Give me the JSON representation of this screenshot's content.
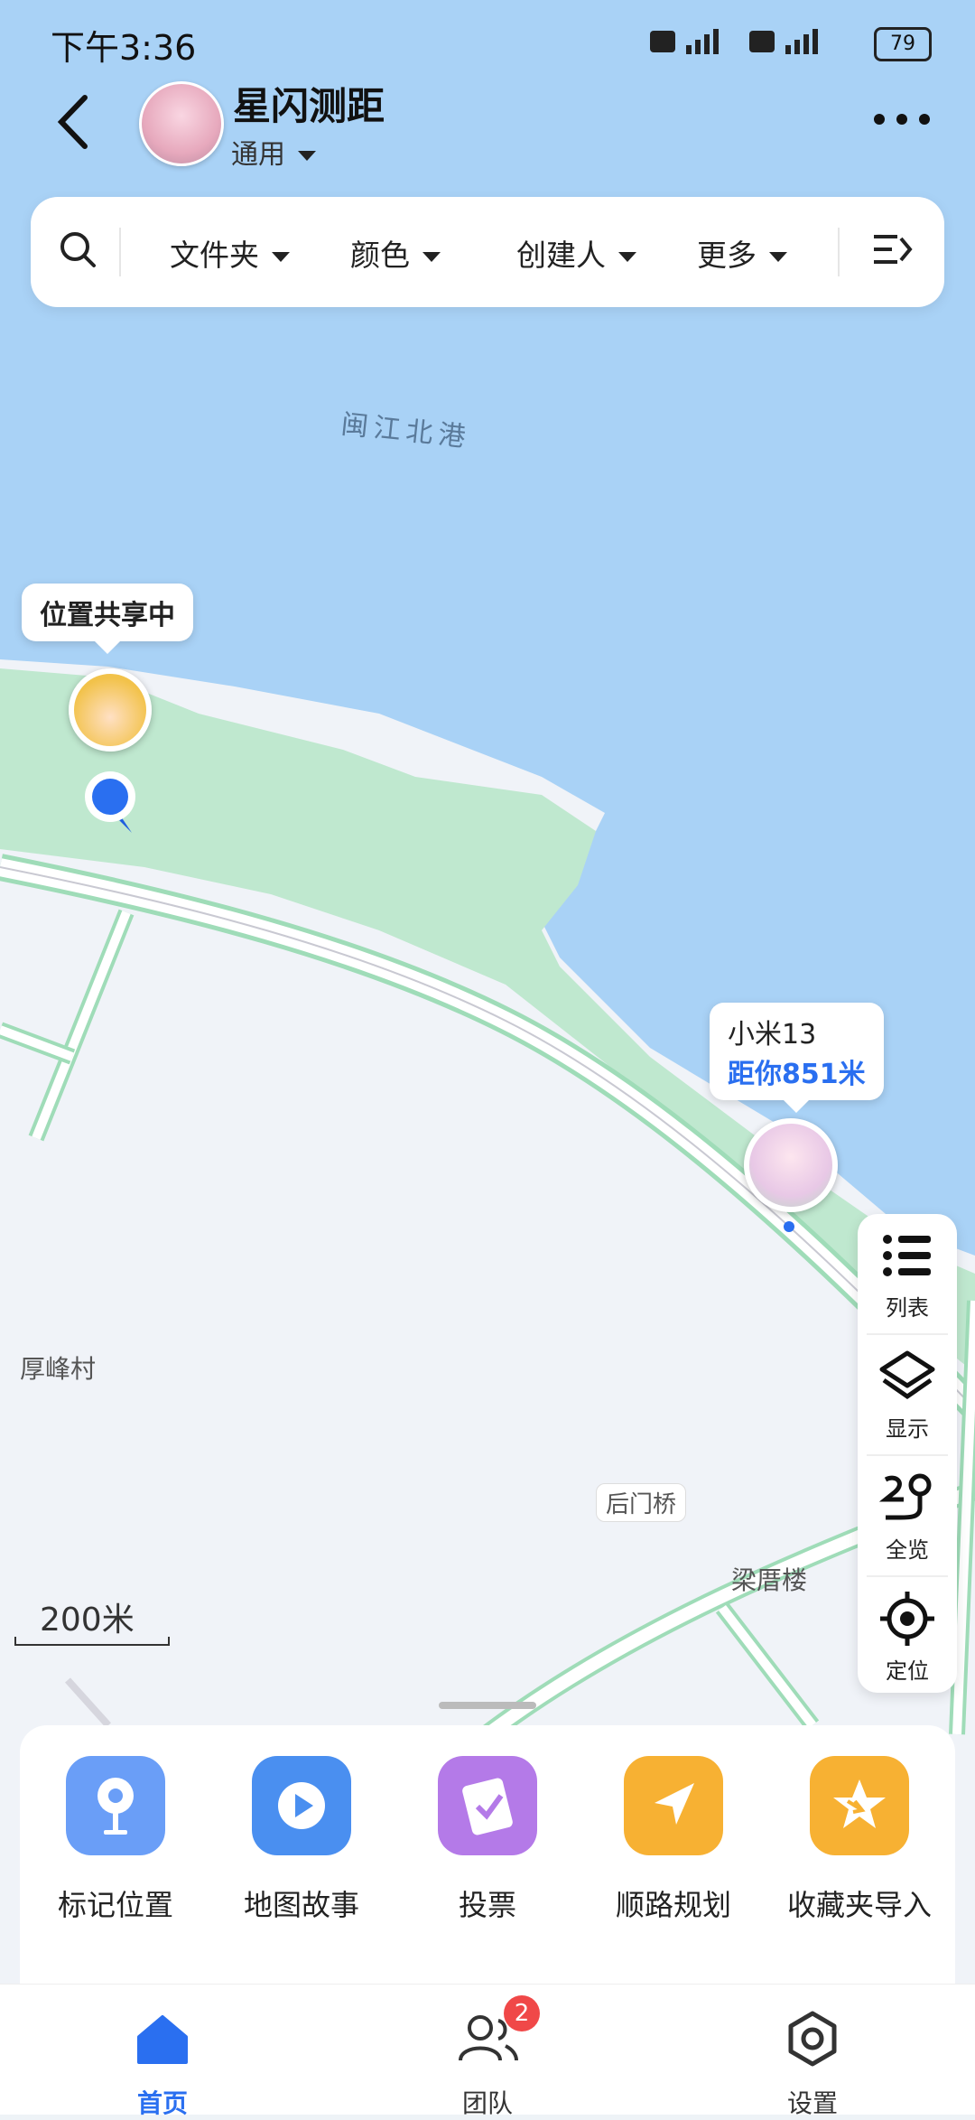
{
  "status_bar": {
    "time": "下午3:36",
    "battery": "79"
  },
  "header": {
    "title": "星闪测距",
    "subtitle": "通用"
  },
  "filters": {
    "items": [
      "文件夹",
      "颜色",
      "创建人",
      "更多"
    ]
  },
  "map": {
    "water_label": "闽江北港",
    "place_labels": [
      "厚峰村",
      "后门桥",
      "梁厝楼"
    ],
    "scale": "200米",
    "self_marker": {
      "label": "位置共享中"
    },
    "friend_marker": {
      "name": "小米13",
      "distance": "距你851米"
    }
  },
  "tools": [
    "列表",
    "显示",
    "全览",
    "定位"
  ],
  "actions": [
    "标记位置",
    "地图故事",
    "投票",
    "顺路规划",
    "收藏夹导入"
  ],
  "tabs": {
    "home": "首页",
    "team": "团队",
    "settings": "设置",
    "team_badge": "2"
  },
  "colors": {
    "accent": "#2a6ff0",
    "water": "#a9d2f6",
    "green": "#bfe8cf"
  }
}
